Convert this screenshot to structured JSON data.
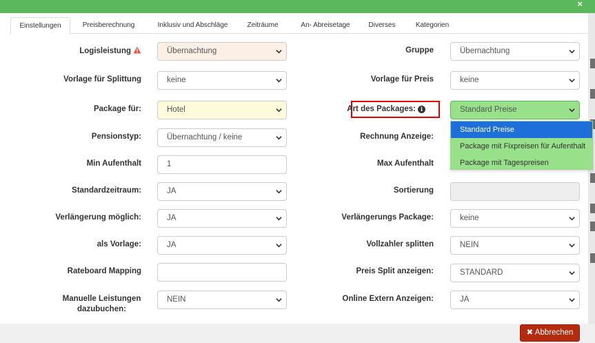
{
  "tabs": [
    {
      "label": "Einstellungen",
      "active": true
    },
    {
      "label": "Preisberechnung"
    },
    {
      "label": "Inklusiv und Abschläge"
    },
    {
      "label": "Zeiträume"
    },
    {
      "label": "An- Abreisetage"
    },
    {
      "label": "Diverses"
    },
    {
      "label": "Kategorien"
    }
  ],
  "form": {
    "logisleistung": {
      "label": "Logisleistung",
      "value": "Übernachtung"
    },
    "gruppe": {
      "label": "Gruppe",
      "value": "Übernachtung"
    },
    "vorlage_splittung": {
      "label": "Vorlage für Splittung",
      "value": "keine"
    },
    "vorlage_preis": {
      "label": "Vorlage für Preis",
      "value": "keine"
    },
    "package_fuer": {
      "label": "Package für:",
      "value": "Hotel"
    },
    "art_des_packages": {
      "label": "Art des Packages:",
      "value": "Standard Preise"
    },
    "pensionstyp": {
      "label": "Pensionstyp:",
      "value": "Übernachtung / keine"
    },
    "rechnung_anzeige": {
      "label": "Rechnung Anzeige:"
    },
    "min_aufenthalt": {
      "label": "Min Aufenthalt",
      "value": "1"
    },
    "max_aufenthalt": {
      "label": "Max Aufenthalt"
    },
    "standardzeitraum": {
      "label": "Standardzeitraum:",
      "value": "JA"
    },
    "sortierung": {
      "label": "Sortierung",
      "value": ""
    },
    "verlaengerung_moeglich": {
      "label": "Verlängerung möglich:",
      "value": "JA"
    },
    "verlaengerungs_package": {
      "label": "Verlängerungs Package:",
      "value": "keine"
    },
    "als_vorlage": {
      "label": "als Vorlage:",
      "value": "JA"
    },
    "vollzahler_splitten": {
      "label": "Vollzahler splitten",
      "value": "NEIN"
    },
    "rateboard_mapping": {
      "label": "Rateboard Mapping",
      "value": ""
    },
    "preis_split_anzeigen": {
      "label": "Preis Split anzeigen:",
      "value": "STANDARD"
    },
    "manuelle_leistungen_line1": "Manuelle Leistungen",
    "manuelle_leistungen_line2": "dazubuchen:",
    "manuelle_leistungen_value": "NEIN",
    "online_extern": {
      "label": "Online Extern Anzeigen:",
      "value": "JA"
    }
  },
  "dropdown_options": [
    {
      "label": "Standard Preise",
      "selected": true
    },
    {
      "label": "Package mit Fixpreisen für Aufenthalt"
    },
    {
      "label": "Package mit Tagespreisen"
    }
  ],
  "footer": {
    "cancel_label": "Abbrechen"
  },
  "icons": {
    "warning": "warning-triangle-icon",
    "info": "info-circle-icon",
    "close": "close-icon",
    "chevron": "chevron-down-icon"
  },
  "colors": {
    "header_green": "#5cb85c",
    "selected_blue": "#1e6fd9",
    "dropdown_green": "#98e08a",
    "highlight_red": "#e00000",
    "cancel_red": "#b52b0e",
    "warning_red": "#e05a4a"
  }
}
